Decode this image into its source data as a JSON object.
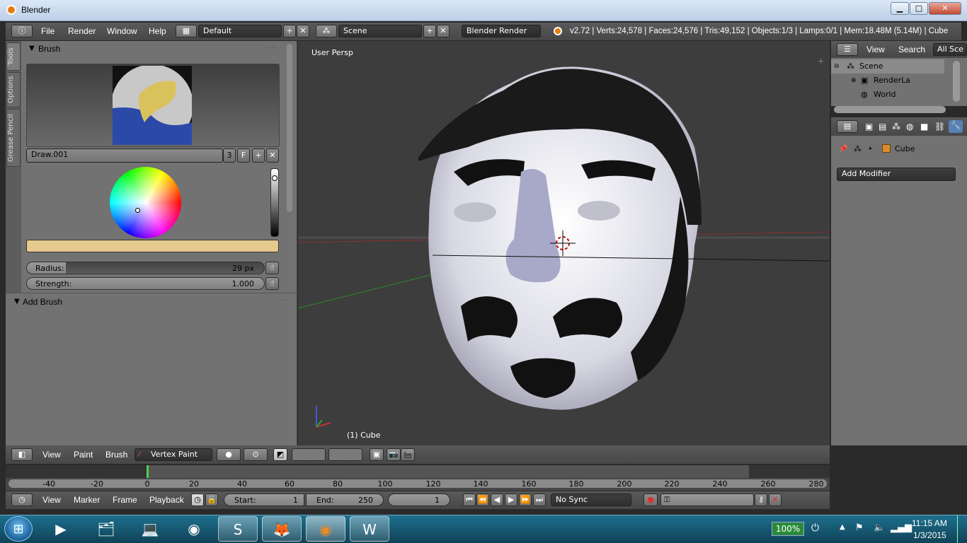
{
  "window": {
    "title": "Blender",
    "minimize": "▁",
    "maximize": "□",
    "close": "✕"
  },
  "infobar": {
    "menus": [
      "File",
      "Render",
      "Window",
      "Help"
    ],
    "layout": "Default",
    "scene": "Scene",
    "engine": "Blender Render",
    "stats": "v2.72 | Verts:24,578 | Faces:24,576 | Tris:49,152 | Objects:1/3 | Lamps:0/1 | Mem:18.48M (5.14M) | Cube"
  },
  "toolshelf": {
    "tabs": [
      "Tools",
      "Options",
      "Grease Pencil"
    ],
    "brush_panel_title": "Brush",
    "brush_name": "Draw.001",
    "brush_users": "3",
    "brush_fake": "F",
    "radius_label": "Radius:",
    "radius_value": "29 px",
    "strength_label": "Strength:",
    "strength_value": "1.000",
    "add_brush_title": "Add Brush",
    "color": "#e5c98d"
  },
  "viewport": {
    "view_label": "User Persp",
    "object_label": "(1) Cube"
  },
  "outliner": {
    "view": "View",
    "search": "Search",
    "filter": "All Sce",
    "items": [
      "Scene",
      "RenderLa",
      "World"
    ]
  },
  "properties": {
    "object_name": "Cube",
    "add_modifier": "Add Modifier"
  },
  "viewport_header": {
    "menus": [
      "View",
      "Paint",
      "Brush"
    ],
    "mode": "Vertex Paint"
  },
  "timeline": {
    "ticks": [
      "-40",
      "-20",
      "0",
      "20",
      "40",
      "60",
      "80",
      "100",
      "120",
      "140",
      "160",
      "180",
      "200",
      "220",
      "240",
      "260",
      "280"
    ],
    "menus": [
      "View",
      "Marker",
      "Frame",
      "Playback"
    ],
    "start_label": "Start:",
    "start_value": "1",
    "end_label": "End:",
    "end_value": "250",
    "current_frame": "1",
    "sync": "No Sync"
  },
  "taskbar": {
    "battery": "100%",
    "time": "11:15 AM",
    "date": "1/3/2015"
  }
}
